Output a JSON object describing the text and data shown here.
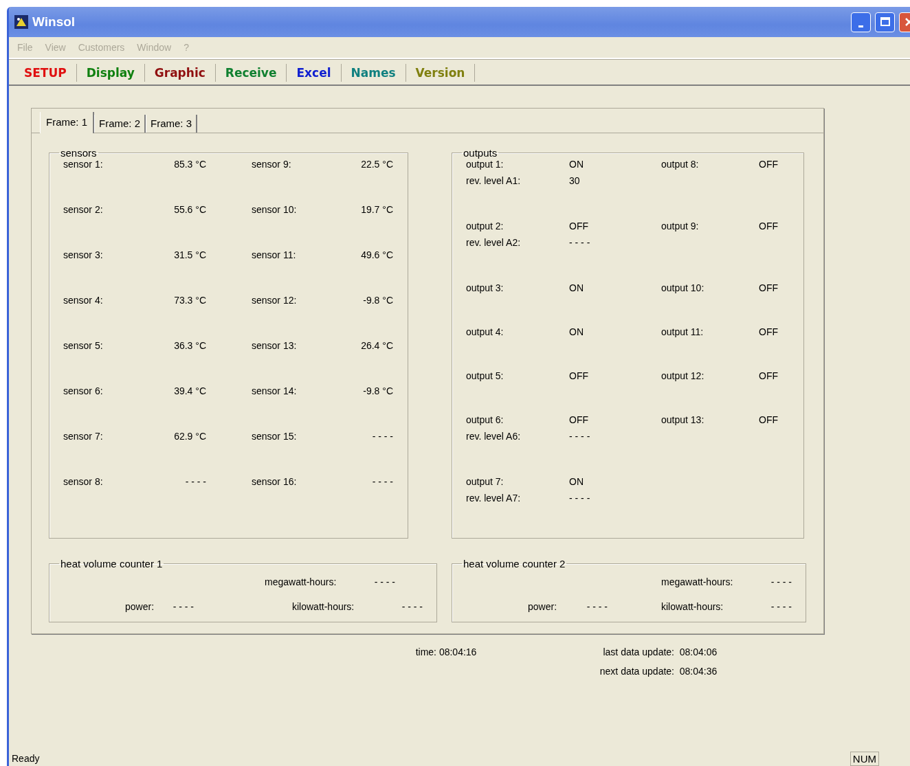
{
  "window": {
    "title": "Winsol"
  },
  "menu": [
    {
      "label": "File",
      "disabled": true
    },
    {
      "label": "View",
      "disabled": true
    },
    {
      "label": "Customers",
      "disabled": true
    },
    {
      "label": "Window",
      "disabled": true
    },
    {
      "label": "?",
      "disabled": true
    }
  ],
  "toolbar": [
    {
      "label": "SETUP",
      "color": "#e01010"
    },
    {
      "label": "Display",
      "color": "#108010"
    },
    {
      "label": "Graphic",
      "color": "#901010"
    },
    {
      "label": "Receive",
      "color": "#108030"
    },
    {
      "label": "Excel",
      "color": "#1020d0"
    },
    {
      "label": "Names",
      "color": "#108080"
    },
    {
      "label": "Version",
      "color": "#808010"
    }
  ],
  "tabs": [
    {
      "label": "Frame: 1",
      "selected": true
    },
    {
      "label": "Frame: 2",
      "selected": false
    },
    {
      "label": "Frame: 3",
      "selected": false
    }
  ],
  "sensors": {
    "title": "sensors",
    "rows": [
      {
        "left": {
          "label": "sensor 1:",
          "value": "85.3 °C"
        },
        "right": {
          "label": "sensor 9:",
          "value": "22.5 °C"
        }
      },
      {
        "left": {
          "label": "sensor 2:",
          "value": "55.6 °C"
        },
        "right": {
          "label": "sensor 10:",
          "value": "19.7 °C"
        }
      },
      {
        "left": {
          "label": "sensor 3:",
          "value": "31.5 °C"
        },
        "right": {
          "label": "sensor 11:",
          "value": "49.6 °C"
        }
      },
      {
        "left": {
          "label": "sensor 4:",
          "value": "73.3 °C"
        },
        "right": {
          "label": "sensor 12:",
          "value": "-9.8 °C"
        }
      },
      {
        "left": {
          "label": "sensor 5:",
          "value": "36.3 °C"
        },
        "right": {
          "label": "sensor 13:",
          "value": "26.4 °C"
        }
      },
      {
        "left": {
          "label": "sensor 6:",
          "value": "39.4 °C"
        },
        "right": {
          "label": "sensor 14:",
          "value": "-9.8 °C"
        }
      },
      {
        "left": {
          "label": "sensor 7:",
          "value": "62.9 °C"
        },
        "right": {
          "label": "sensor 15:",
          "value": "- - - -"
        }
      },
      {
        "left": {
          "label": "sensor 8:",
          "value": "- - - -"
        },
        "right": {
          "label": "sensor 16:",
          "value": "- - - -"
        }
      }
    ]
  },
  "outputs": {
    "title": "outputs",
    "rows": [
      {
        "left": {
          "label": "output 1:",
          "value": "ON"
        },
        "rev_level": {
          "label": "rev. level A1:",
          "value": "30"
        },
        "right": {
          "label": "output 8:",
          "value": "OFF"
        }
      },
      {
        "left": {
          "label": "output 2:",
          "value": "OFF"
        },
        "rev_level": {
          "label": "rev. level A2:",
          "value": "- - - -"
        },
        "right": {
          "label": "output 9:",
          "value": "OFF"
        }
      },
      {
        "left": {
          "label": "output 3:",
          "value": "ON"
        },
        "right": {
          "label": "output 10:",
          "value": "OFF"
        }
      },
      {
        "left": {
          "label": "output 4:",
          "value": "ON"
        },
        "right": {
          "label": "output 11:",
          "value": "OFF"
        }
      },
      {
        "left": {
          "label": "output 5:",
          "value": "OFF"
        },
        "right": {
          "label": "output 12:",
          "value": "OFF"
        }
      },
      {
        "left": {
          "label": "output 6:",
          "value": "OFF"
        },
        "rev_level": {
          "label": "rev. level A6:",
          "value": "- - - -"
        },
        "right": {
          "label": "output 13:",
          "value": "OFF"
        }
      },
      {
        "left": {
          "label": "output 7:",
          "value": "ON"
        },
        "rev_level": {
          "label": "rev. level A7:",
          "value": "- - - -"
        }
      }
    ]
  },
  "heat_counters": [
    {
      "title": "heat volume counter 1",
      "megawatt_hours": {
        "label": "megawatt-hours:",
        "value": "- - - -"
      },
      "power": {
        "label": "power:",
        "value": "- - - -"
      },
      "kilowatt_hours": {
        "label": "kilowatt-hours:",
        "value": "- - - -"
      }
    },
    {
      "title": "heat volume counter 2",
      "megawatt_hours": {
        "label": "megawatt-hours:",
        "value": "- - - -"
      },
      "power": {
        "label": "power:",
        "value": "- - - -"
      },
      "kilowatt_hours": {
        "label": "kilowatt-hours:",
        "value": "- - - -"
      }
    }
  ],
  "time": {
    "label": "time:",
    "value": "08:04:16"
  },
  "last_update": {
    "label": "last data update:",
    "value": "08:04:06"
  },
  "next_update": {
    "label": "next data update:",
    "value": "08:04:36"
  },
  "status_bar": {
    "text": "Ready",
    "indicators": [
      "NUM"
    ]
  }
}
